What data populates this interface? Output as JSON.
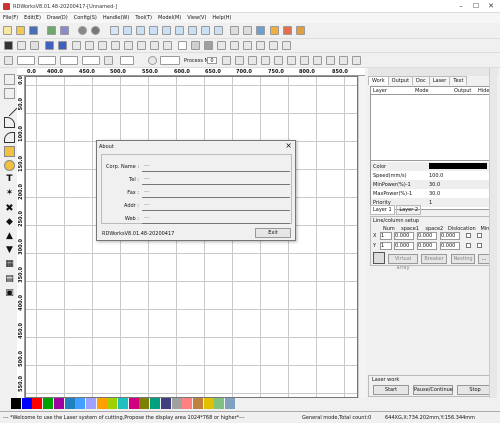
{
  "window": {
    "title": "RDWorksV8.01.48-20200417-[Unnamed-]"
  },
  "menu": [
    "File(F)",
    "Edit(E)",
    "Draw(D)",
    "Config(S)",
    "Handle(W)",
    "Tool(T)",
    "Model(M)",
    "View(V)",
    "Help(H)"
  ],
  "toolbar2": {
    "process_no_label": "Process NO:",
    "process_no_value": "0"
  },
  "ruler": {
    "h": [
      "0.0",
      "400.0",
      "450.0",
      "500.0",
      "550.0",
      "600.0",
      "650.0",
      "700.0",
      "750.0",
      "800.0",
      "850.0"
    ],
    "v": [
      "0.0",
      "50.0",
      "100.0",
      "150.0",
      "200.0",
      "250.0",
      "300.0",
      "350.0",
      "400.0",
      "450.0",
      "500.0",
      "550.0",
      "600.0"
    ]
  },
  "panel": {
    "tabs": [
      "Work",
      "Output",
      "Doc",
      "Laser",
      "Text"
    ],
    "work_headers": [
      "Layer",
      "Mode",
      "Output",
      "Hide"
    ],
    "params": [
      {
        "k": "Color",
        "v": ""
      },
      {
        "k": "Speed(mm/s)",
        "v": "100.0"
      },
      {
        "k": "MinPower(%)-1",
        "v": "30.0"
      },
      {
        "k": "MaxPower(%)-1",
        "v": "30.0"
      },
      {
        "k": "Priority",
        "v": "1"
      }
    ],
    "layer_tabs": [
      "Layer 1",
      "Layer 2"
    ],
    "line_setup": "Line/column setup",
    "grid_headers": [
      "Num",
      "space1",
      "space2",
      "Dislocation",
      "Mirror"
    ],
    "rows": [
      {
        "axis": "X",
        "num": "1",
        "s1": "0.000",
        "s2": "0.000",
        "dis": "0.000"
      },
      {
        "axis": "Y",
        "num": "1",
        "s1": "0.000",
        "s2": "0.000",
        "dis": "0.000"
      }
    ],
    "grid_buttons": [
      "Virtual array",
      "Breaker",
      "Nesting",
      "..."
    ],
    "laserwork_title": "Laser work",
    "laser_buttons": [
      "Start",
      "Pause/Continue",
      "Stop"
    ]
  },
  "about": {
    "title": "About",
    "fields": [
      {
        "label": "Corp. Name :",
        "value": "---"
      },
      {
        "label": "Tel :",
        "value": "---"
      },
      {
        "label": "Fax :",
        "value": "---"
      },
      {
        "label": "Addr :",
        "value": "---"
      },
      {
        "label": "Web :",
        "value": "---"
      }
    ],
    "version": "RDWorksV8.01.48-20200417",
    "exit": "Exit"
  },
  "palette": [
    "#000000",
    "#0000ff",
    "#ff0000",
    "#00a000",
    "#a000a0",
    "#2080c0",
    "#40a0ff",
    "#a0a0ff",
    "#ffa000",
    "#a0d000",
    "#20c0c0",
    "#d00080",
    "#808000",
    "#00a080",
    "#404080",
    "#a0a0a0",
    "#ff8080",
    "#c08040",
    "#e0c000",
    "#80c080",
    "#80a0c0"
  ],
  "status": {
    "message": "--- *Welcome to use the Laser system of cutting,Propose the display area 1024*768 or higher*---",
    "mode": "General mode,Total count:0",
    "coords": "644XG,X:734.202mm,Y:156.344mm"
  }
}
